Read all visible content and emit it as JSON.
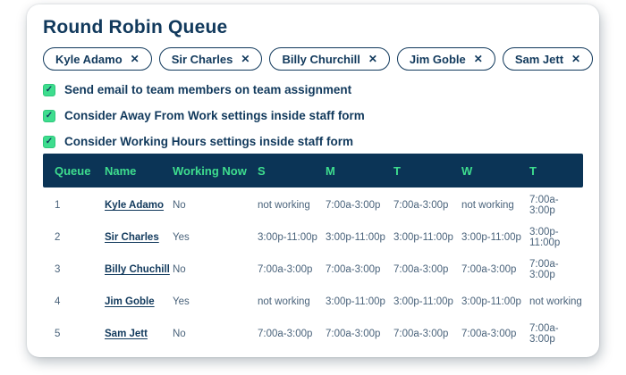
{
  "page": {
    "title": "Round Robin Queue"
  },
  "icons": {
    "check": "✓",
    "close": "✕"
  },
  "colors": {
    "navy_text": "#11395C",
    "header_bg": "#0B3456",
    "accent_green": "#3EDD8E",
    "body_text": "#4A637B"
  },
  "chips": [
    {
      "label": "Kyle Adamo"
    },
    {
      "label": "Sir Charles"
    },
    {
      "label": "Billy Churchill"
    },
    {
      "label": "Jim Goble"
    },
    {
      "label": "Sam Jett"
    }
  ],
  "checkboxes": [
    {
      "label": "Send email to team members on team assignment",
      "checked": true
    },
    {
      "label": "Consider Away From Work settings inside staff form",
      "checked": true
    },
    {
      "label": "Consider Working Hours settings inside staff form",
      "checked": true
    }
  ],
  "table": {
    "headers": [
      "Queue",
      "Name",
      "Working Now",
      "S",
      "M",
      "T",
      "W",
      "T"
    ],
    "rows": [
      {
        "queue": "1",
        "name": "Kyle Adamo",
        "working_now": "No",
        "days": [
          "not working",
          "7:00a-3:00p",
          "7:00a-3:00p",
          "not working",
          "7:00a-3:00p"
        ]
      },
      {
        "queue": "2",
        "name": "Sir Charles",
        "working_now": "Yes",
        "days": [
          "3:00p-11:00p",
          "3:00p-11:00p",
          "3:00p-11:00p",
          "3:00p-11:00p",
          "3:00p-11:00p"
        ]
      },
      {
        "queue": "3",
        "name": "Billy Chuchill",
        "working_now": "No",
        "days": [
          "7:00a-3:00p",
          "7:00a-3:00p",
          "7:00a-3:00p",
          "7:00a-3:00p",
          "7:00a-3:00p"
        ]
      },
      {
        "queue": "4",
        "name": "Jim Goble",
        "working_now": "Yes",
        "days": [
          "not working",
          "3:00p-11:00p",
          "3:00p-11:00p",
          "3:00p-11:00p",
          "not working"
        ]
      },
      {
        "queue": "5",
        "name": "Sam Jett",
        "working_now": "No",
        "days": [
          "7:00a-3:00p",
          "7:00a-3:00p",
          "7:00a-3:00p",
          "7:00a-3:00p",
          "7:00a-3:00p"
        ]
      }
    ]
  }
}
